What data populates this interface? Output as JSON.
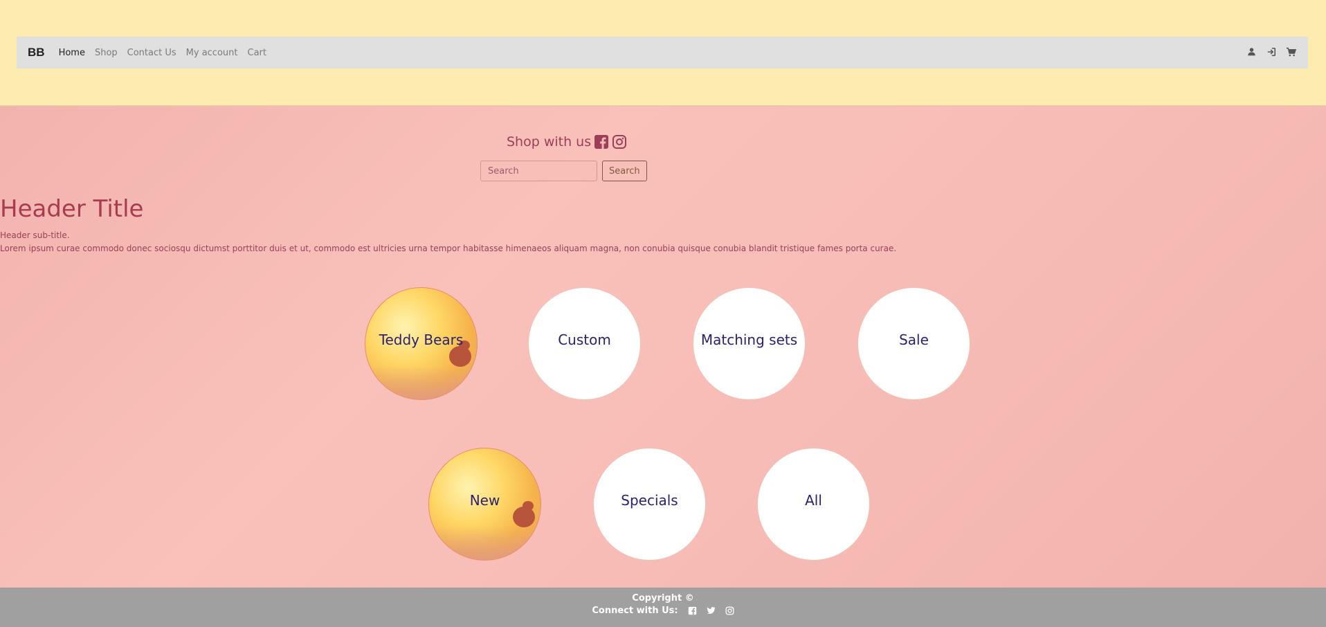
{
  "navbar": {
    "brand": "BB",
    "links": [
      "Home",
      "Shop",
      "Contact Us",
      "My account",
      "Cart"
    ],
    "icons": [
      "user-icon",
      "sign-in-icon",
      "cart-icon"
    ]
  },
  "shop": {
    "label": "Shop with us",
    "icons": [
      "facebook-icon",
      "instagram-icon"
    ]
  },
  "search": {
    "placeholder": "Search",
    "button_label": "Search"
  },
  "hero": {
    "title": "Header Title",
    "subtitle": "Header sub-title.",
    "body": "Lorem ipsum curae commodo donec sociosqu dictumst porttitor duis et ut, commodo est ultricies urna tempor habitasse himenaeos aliquam magna, non conubia quisque conubia blandit tristique fames porta curae."
  },
  "categories": [
    {
      "label": "Teddy Bears",
      "style": "photo"
    },
    {
      "label": "Custom",
      "style": "plain"
    },
    {
      "label": "Matching sets",
      "style": "plain"
    },
    {
      "label": "Sale",
      "style": "plain"
    },
    {
      "label": "New",
      "style": "photo"
    },
    {
      "label": "Specials",
      "style": "plain"
    },
    {
      "label": "All",
      "style": "plain"
    }
  ],
  "footer": {
    "copyright": "Copyright ©",
    "connect_label": "Connect with Us:",
    "icons": [
      "facebook-icon",
      "twitter-icon",
      "instagram-icon"
    ]
  },
  "colors": {
    "top_band": "#feebb0",
    "navbar": "#e0e0e0",
    "main_bg": "#f6b8b2",
    "accent_text": "#9c3e58",
    "circle_text": "#2a2170",
    "footer": "#a0a0a0"
  }
}
